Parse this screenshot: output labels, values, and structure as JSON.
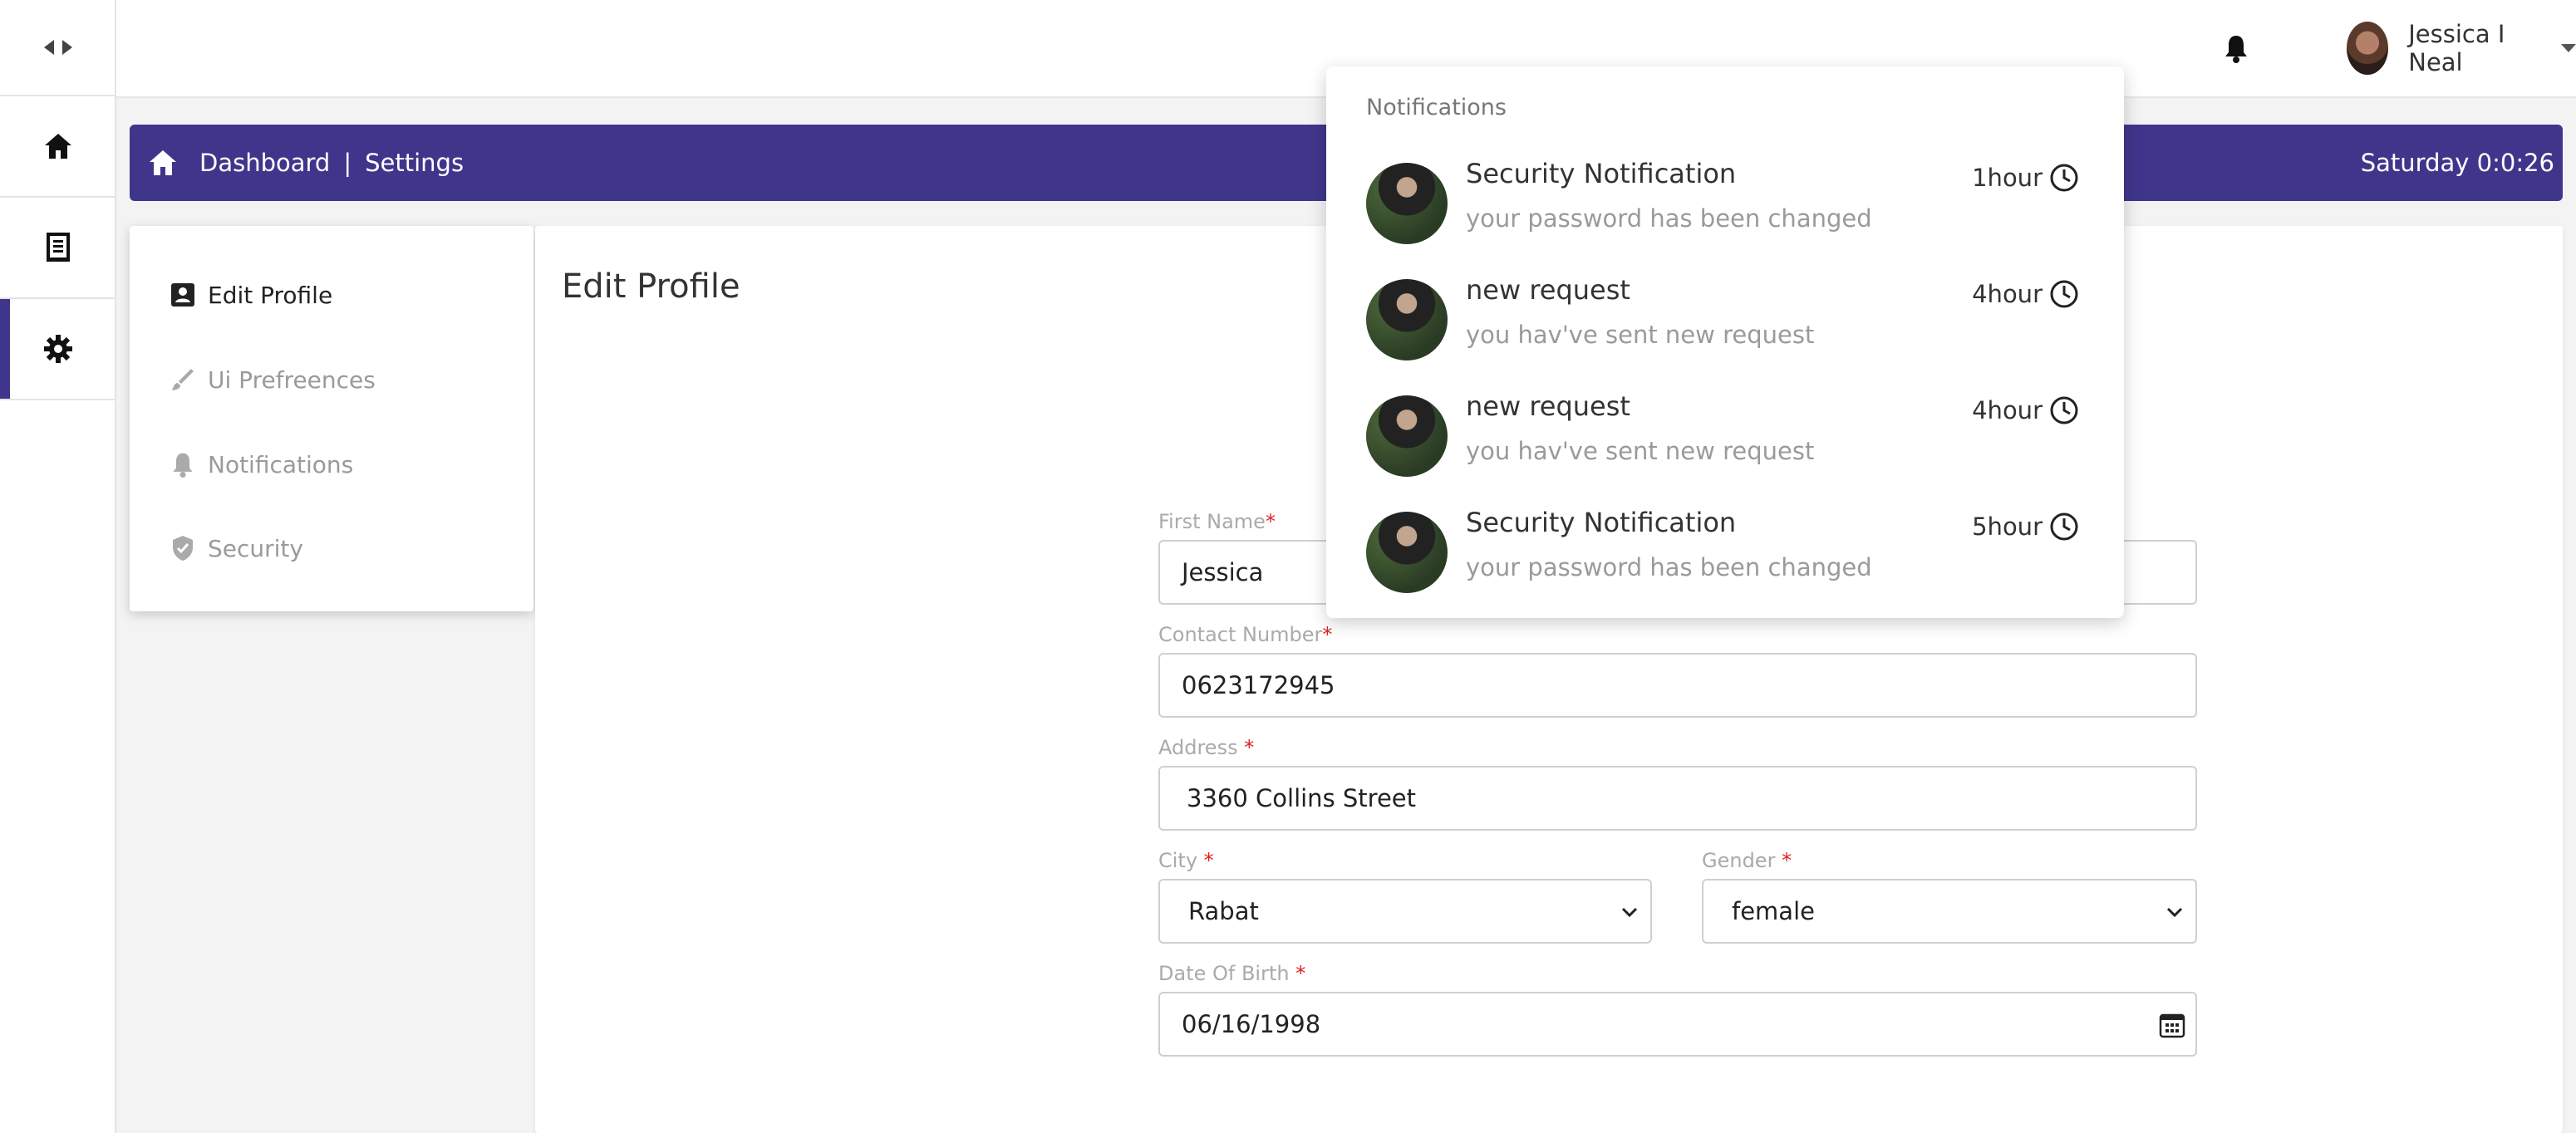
{
  "icons": {
    "rail_toggle": "code-arrows-icon",
    "rail_home": "home-icon",
    "rail_docs": "document-icon",
    "rail_settings": "gear-icon",
    "bell": "bell-icon",
    "caret": "caret-down-icon",
    "breadcrumb_home": "home-icon",
    "clock": "clock-icon",
    "calendar": "calendar-icon"
  },
  "colors": {
    "accent": "#3f368b",
    "required": "#e02020"
  },
  "header": {
    "user_name": "Jessica I Neal"
  },
  "breadcrumb": {
    "section": "Dashboard",
    "separator": "|",
    "page": "Settings",
    "clock": "Saturday 0:0:26"
  },
  "settings_menu": {
    "items": [
      {
        "label": "Edit Profile",
        "active": true
      },
      {
        "label": "Ui Prefreences",
        "active": false
      },
      {
        "label": "Notifications",
        "active": false
      },
      {
        "label": "Security",
        "active": false
      }
    ]
  },
  "form": {
    "title": "Edit Profile",
    "first_name": {
      "label": "First Name",
      "required": "*",
      "value": "Jessica"
    },
    "contact": {
      "label": "Contact Number",
      "required": "*",
      "value": "0623172945"
    },
    "address": {
      "label": "Address ",
      "required": "*",
      "value": "3360 Collins Street"
    },
    "city": {
      "label": "City ",
      "required": "*",
      "value": "Rabat"
    },
    "gender": {
      "label": "Gender ",
      "required": "*",
      "value": "female"
    },
    "dob": {
      "label": "Date Of Birth ",
      "required": "*",
      "value": "06/16/1998"
    }
  },
  "notifications": {
    "heading": "Notifications",
    "items": [
      {
        "title": "Security Notification",
        "desc": "your password has been changed",
        "time": "1hour"
      },
      {
        "title": "new request",
        "desc": "you hav've sent new request",
        "time": "4hour"
      },
      {
        "title": "new request",
        "desc": "you hav've sent new request",
        "time": "4hour"
      },
      {
        "title": "Security Notification",
        "desc": "your password has been changed",
        "time": "5hour"
      }
    ]
  }
}
